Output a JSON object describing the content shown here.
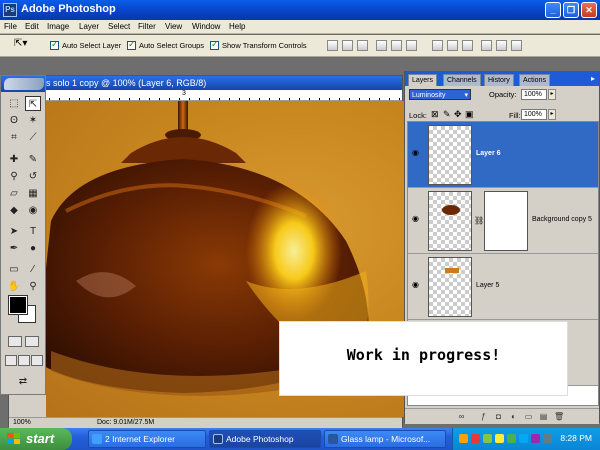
{
  "app": {
    "title": "Adobe Photoshop",
    "icon_label": "Ps",
    "window_controls": [
      "minimize-icon",
      "restore-icon",
      "close-icon"
    ]
  },
  "menu": [
    "File",
    "Edit",
    "Image",
    "Layer",
    "Select",
    "Filter",
    "View",
    "Window",
    "Help"
  ],
  "options_bar": {
    "auto_select_layer": "Auto Select Layer",
    "auto_select_groups": "Auto Select Groups",
    "show_transform_controls": "Show Transform Controls"
  },
  "document": {
    "title": "s solo 1 copy @ 100% (Layer 6, RGB/8)",
    "ruler_mark": "3",
    "zoom": "100%",
    "doc_size": "Doc: 9.01M/27.5M"
  },
  "layers_panel": {
    "tabs": [
      "Layers",
      "Channels",
      "History",
      "Actions"
    ],
    "blend_mode": "Luminosity",
    "opacity_label": "Opacity:",
    "opacity_value": "100%",
    "lock_label": "Lock:",
    "fill_label": "Fill:",
    "fill_value": "100%",
    "layers": [
      {
        "name": "Layer 6",
        "selected": true
      },
      {
        "name": "Background copy 5",
        "selected": false
      },
      {
        "name": "Layer 5",
        "selected": false
      }
    ]
  },
  "overlay_text": "Work in progress!",
  "taskbar": {
    "start": "start",
    "buttons": [
      "2 Internet Explorer",
      "Adobe Photoshop",
      "Glass lamp - Microsof..."
    ],
    "clock": "8:28 PM"
  },
  "colors": {
    "xp_blue": "#245edb",
    "selection_blue": "#316ac5",
    "lamp_amber": "#c9871f",
    "start_green": "#3c8e3c"
  }
}
